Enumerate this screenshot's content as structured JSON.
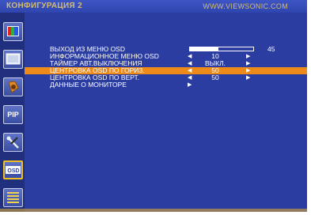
{
  "header": {
    "title": "КОНФИГУРАЦИЯ 2",
    "website": "WWW.VIEWSONIC.COM"
  },
  "sidebar": {
    "icons": [
      {
        "name": "color-icon"
      },
      {
        "name": "screen-icon"
      },
      {
        "name": "audio-icon"
      },
      {
        "name": "pip-icon",
        "label": "PIP"
      },
      {
        "name": "setup-tools-icon"
      },
      {
        "name": "osd-config-icon",
        "label": "OSD"
      },
      {
        "name": "menu-list-icon"
      }
    ]
  },
  "menu": {
    "items": [
      {
        "label": "ВЫХОД ИЗ МЕНЮ OSD",
        "type": "bar",
        "value": "45",
        "level": 0.45
      },
      {
        "label": "ИНФОРМАЦИОННОЕ МЕНЮ OSD",
        "type": "select",
        "value": "10"
      },
      {
        "label": "ТАЙМЕР АВТ.ВЫКЛЮЧЕНИЯ",
        "type": "select",
        "value": "ВЫКЛ."
      },
      {
        "label": "ЦЕНТРОВКА OSD ПО ГОРИЗ.",
        "type": "select",
        "value": "50",
        "selected": true
      },
      {
        "label": "ЦЕНТРОВКА OSD ПО ВЕРТ.",
        "type": "select",
        "value": "50"
      },
      {
        "label": "ДАННЫЕ О МОНИТОРЕ",
        "type": "submenu"
      }
    ]
  },
  "colors": {
    "background": "#2b3da0",
    "header": "#3d55c4",
    "highlight": "#ec8a1a",
    "text": "#ffffff",
    "title_text": "#d2bc72"
  }
}
